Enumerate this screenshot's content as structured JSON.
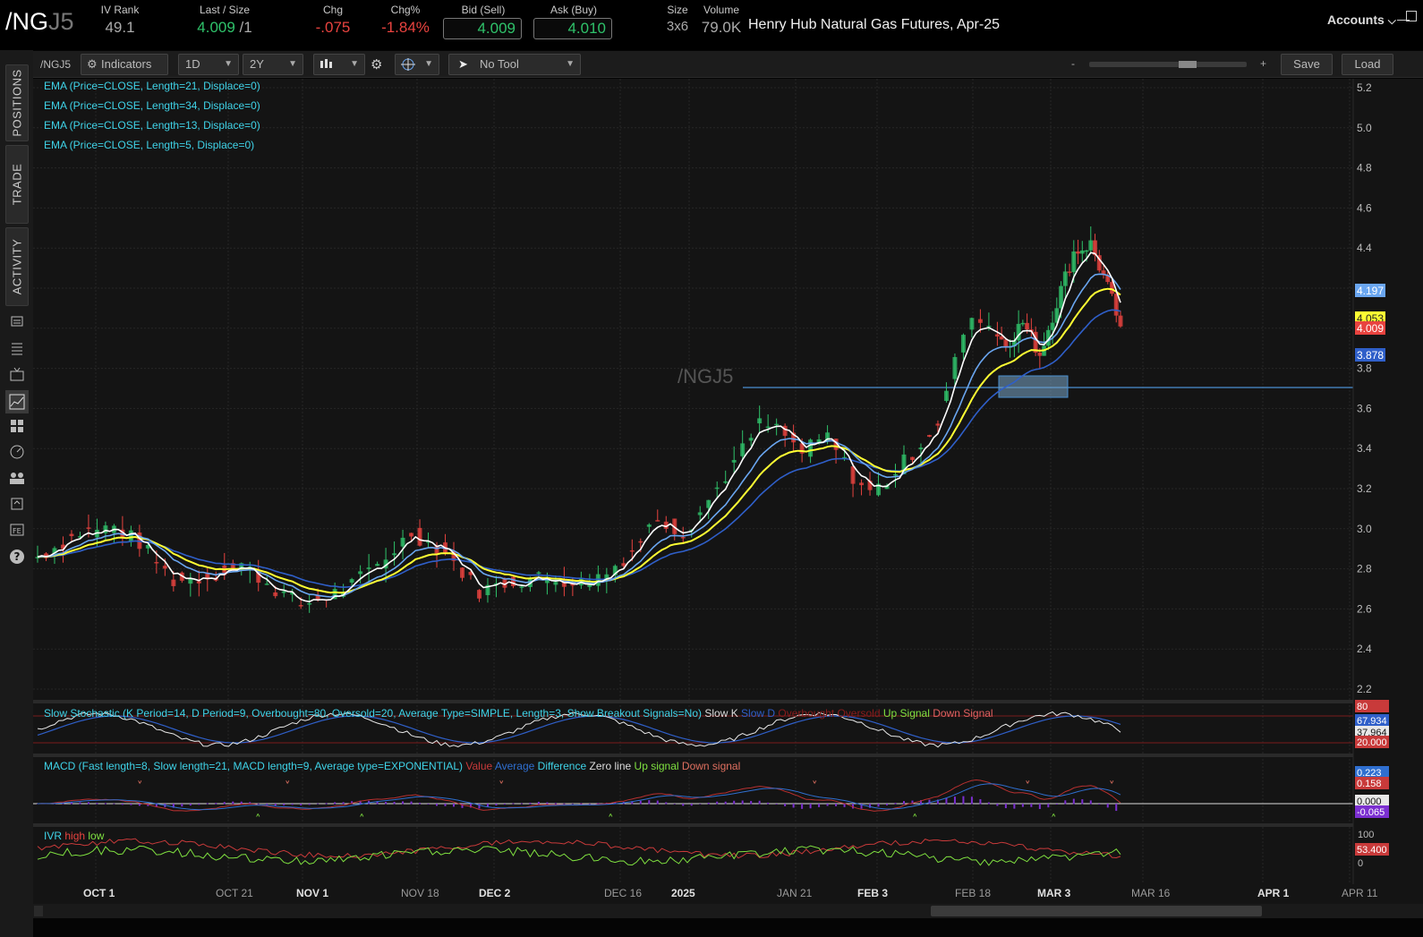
{
  "header": {
    "symbol_main": "/NG",
    "symbol_dim": "J5",
    "iv_rank_label": "IV Rank",
    "iv_rank_value": "49.1",
    "last_size_label": "Last / Size",
    "last_value": "4.009",
    "size_value": " /1",
    "chg_label": "Chg",
    "chg_value": "-.075",
    "chgpct_label": "Chg%",
    "chgpct_value": "-1.84%",
    "bid_label": "Bid (Sell)",
    "bid_value": "4.009",
    "ask_label": "Ask (Buy)",
    "ask_value": "4.010",
    "size_label": "Size",
    "size_val": "3x6",
    "volume_label": "Volume",
    "volume_value": "79.0K",
    "instrument_name": "Henry Hub Natural Gas Futures, Apr-25",
    "accounts_label": "Accounts"
  },
  "colors": {
    "up": "#2fc26a",
    "down": "#e8433f",
    "ema5": "#ffffff",
    "ema13": "#6aa6f0",
    "ema21": "#ffff33",
    "ema34": "#2f5fc9",
    "legend_cyan": "#3fd3e8"
  },
  "sidetabs": {
    "positions": "POSITIONS",
    "trade": "TRADE",
    "activity": "ACTIVITY"
  },
  "side_icons": [
    "monitor-icon",
    "list-icon",
    "tv-icon",
    "chart-icon",
    "grid-icon",
    "gauge-icon",
    "people-icon",
    "history-icon",
    "fe-icon",
    "help-icon"
  ],
  "toolbar": {
    "symbol": "/NGJ5",
    "indicators_label": "Indicators",
    "timeframe": "1D",
    "range": "2Y",
    "tool": "No Tool",
    "zoom_minus": "-",
    "zoom_plus": "+",
    "save_label": "Save",
    "load_label": "Load"
  },
  "chart": {
    "watermark": "/NGJ5",
    "ema_legends": [
      "EMA (Price=CLOSE, Length=21, Displace=0)",
      "EMA (Price=CLOSE, Length=34, Displace=0)",
      "EMA (Price=CLOSE, Length=13, Displace=0)",
      "EMA (Price=CLOSE, Length=5, Displace=0)"
    ],
    "price_ticks": [
      "5.2",
      "5.0",
      "4.8",
      "4.6",
      "4.4",
      "4.2",
      "4.0",
      "3.8",
      "3.6",
      "3.4",
      "3.2",
      "3.0",
      "2.8",
      "2.6",
      "2.4",
      "2.2"
    ],
    "price_labels": [
      {
        "text": "4.197",
        "color": "#6aa6f0"
      },
      {
        "text": "4.053",
        "color": "#ffff33"
      },
      {
        "text": "4.009",
        "color": "#e8433f"
      },
      {
        "text": "3.878",
        "color": "#2f5fc9"
      }
    ],
    "x_labels": [
      {
        "text": "OCT 1",
        "bold": true
      },
      {
        "text": "OCT 21",
        "bold": false
      },
      {
        "text": "NOV 1",
        "bold": true
      },
      {
        "text": "NOV 18",
        "bold": false
      },
      {
        "text": "DEC 2",
        "bold": true
      },
      {
        "text": "DEC 16",
        "bold": false
      },
      {
        "text": "2025",
        "bold": true
      },
      {
        "text": "JAN 21",
        "bold": false
      },
      {
        "text": "FEB 3",
        "bold": true
      },
      {
        "text": "FEB 18",
        "bold": false
      },
      {
        "text": "MAR 3",
        "bold": true
      },
      {
        "text": "MAR 16",
        "bold": false
      },
      {
        "text": "APR 1",
        "bold": true
      },
      {
        "text": "APR 11",
        "bold": false
      }
    ]
  },
  "stochastic": {
    "legend_main": "Slow Stochastic (K Period=14, D Period=9, Overbought=80, Oversold=20, Average Type=SIMPLE, Length=3, Show Breakout Signals=No)",
    "slow_k": "Slow K",
    "slow_d": "Slow D",
    "overbought": "Overbought",
    "oversold": "Oversold",
    "up_signal": "Up Signal",
    "down_signal": "Down Signal",
    "labels": [
      {
        "text": "80",
        "color": "#c83a3a"
      },
      {
        "text": "67.934",
        "color": "#2f5fc9"
      },
      {
        "text": "37.964",
        "color": "#e8e8e8"
      },
      {
        "text": "20.000",
        "color": "#c83a3a"
      }
    ]
  },
  "macd": {
    "legend_main": "MACD (Fast length=8, Slow length=21, MACD length=9, Average type=EXPONENTIAL)",
    "value": "Value",
    "average": "Average",
    "difference": "Difference",
    "zero_line": "Zero line",
    "up_signal": "Up signal",
    "down_signal": "Down signal",
    "labels": [
      {
        "text": "0.223",
        "color": "#2f6fd0"
      },
      {
        "text": "0.158",
        "color": "#c83a3a"
      },
      {
        "text": "0.000",
        "color": "#e8e8e8"
      },
      {
        "text": "-0.065",
        "color": "#7b2fd0"
      }
    ]
  },
  "ivr": {
    "legend_main": "IVR",
    "high": "high",
    "low": "low",
    "ticks": [
      "100",
      "0"
    ],
    "labels": [
      {
        "text": "53.400",
        "color": "#c83a3a"
      }
    ]
  }
}
